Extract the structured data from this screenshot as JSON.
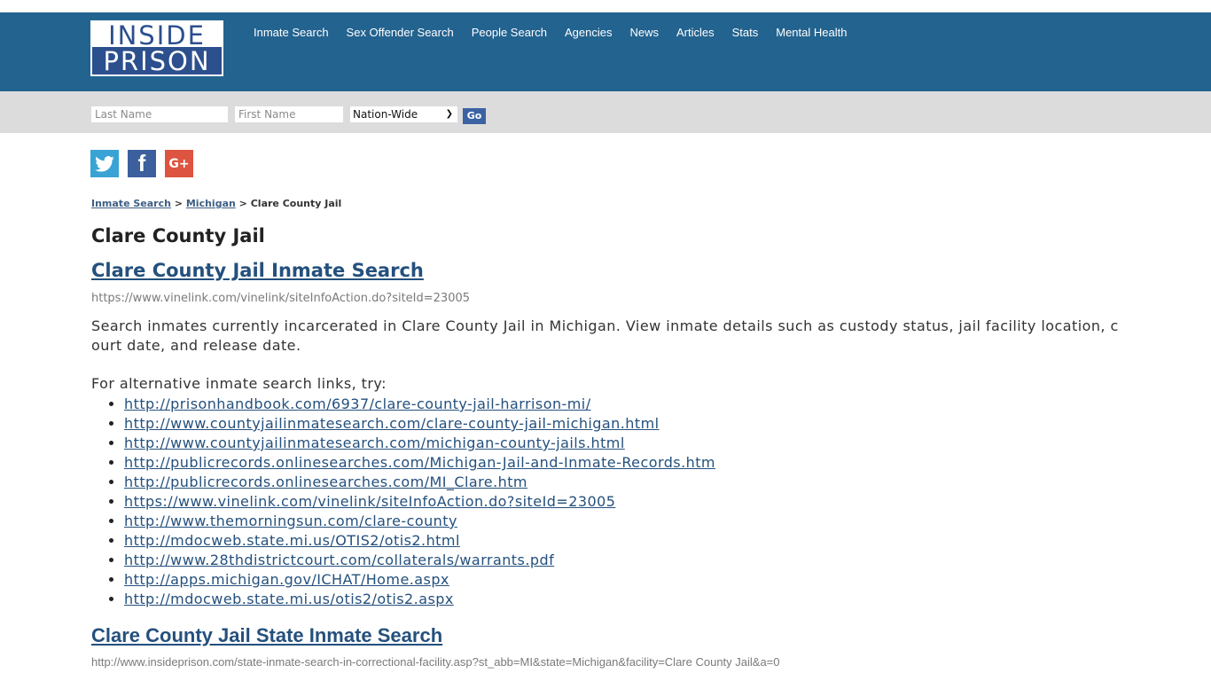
{
  "header": {
    "logo": {
      "line1": "INSIDE",
      "line2": "PRISON"
    },
    "nav": [
      "Inmate Search",
      "Sex Offender Search",
      "People Search",
      "Agencies",
      "News",
      "Articles",
      "Stats",
      "Mental Health"
    ]
  },
  "search": {
    "last_name_placeholder": "Last Name",
    "first_name_placeholder": "First Name",
    "scope_selected": "Nation-Wide",
    "go_label": "Go"
  },
  "social": {
    "twitter": "twitter-icon",
    "facebook": "facebook-icon",
    "googleplus": "google-plus-icon",
    "facebook_glyph": "f",
    "googleplus_glyph": "G+"
  },
  "breadcrumb": {
    "items": [
      "Inmate Search",
      "Michigan"
    ],
    "separator": ">",
    "current": "Clare County Jail"
  },
  "page": {
    "title": "Clare County Jail",
    "section1": {
      "heading": "Clare County Jail Inmate Search",
      "url": "https://www.vinelink.com/vinelink/siteInfoAction.do?siteId=23005",
      "description": "Search inmates currently incarcerated in Clare County Jail in Michigan. View inmate details such as custody status, jail facility location, court date, and release date.",
      "alt_intro": "For alternative inmate search links, try:",
      "links": [
        "http://prisonhandbook.com/6937/clare-county-jail-harrison-mi/",
        "http://www.countyjailinmatesearch.com/clare-county-jail-michigan.html",
        "http://www.countyjailinmatesearch.com/michigan-county-jails.html",
        "http://publicrecords.onlinesearches.com/Michigan-Jail-and-Inmate-Records.htm",
        "http://publicrecords.onlinesearches.com/MI_Clare.htm",
        "https://www.vinelink.com/vinelink/siteInfoAction.do?siteId=23005",
        "http://www.themorningsun.com/clare-county",
        "http://mdocweb.state.mi.us/OTIS2/otis2.html",
        "http://www.28thdistrictcourt.com/collaterals/warrants.pdf",
        "http://apps.michigan.gov/ICHAT/Home.aspx",
        "http://mdocweb.state.mi.us/otis2/otis2.aspx"
      ]
    },
    "section2": {
      "heading": "Clare County Jail State Inmate Search",
      "url": "http://www.insideprison.com/state-inmate-search-in-correctional-facility.asp?st_abb=MI&state=Michigan&facility=Clare County Jail&a=0"
    }
  },
  "colors": {
    "header_bg": "#23638f",
    "search_bg": "#dcdcdc",
    "link": "#24507d",
    "go_button": "#3b62a3",
    "twitter": "#38a3d4",
    "facebook": "#3c5f9e",
    "googleplus": "#dd5440"
  }
}
